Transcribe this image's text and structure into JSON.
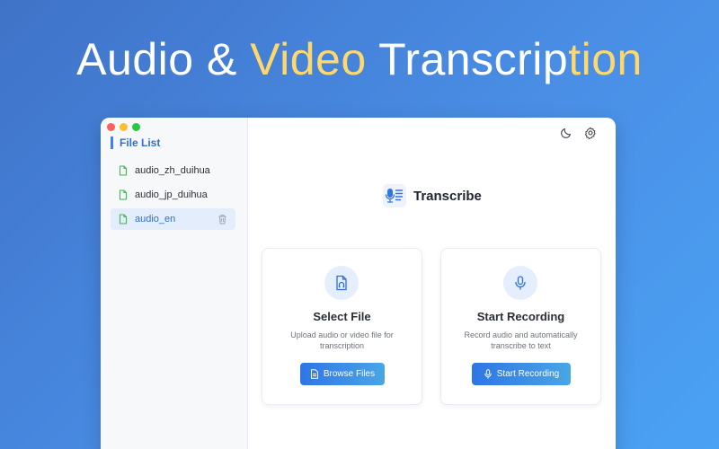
{
  "hero": {
    "title_main": "Audio & ",
    "title_highlight_1": "Video",
    "title_middle": " Transcrip",
    "title_highlight_2": "tion"
  },
  "sidebar": {
    "title": "File List",
    "files": [
      {
        "name": "audio_zh_duihua",
        "active": false
      },
      {
        "name": "audio_jp_duihua",
        "active": false
      },
      {
        "name": "audio_en",
        "active": true
      }
    ]
  },
  "app": {
    "name": "Transcribe"
  },
  "cards": {
    "select_file": {
      "title": "Select File",
      "description": "Upload audio or video file for transcription",
      "button_label": "Browse Files"
    },
    "recording": {
      "title": "Start Recording",
      "description": "Record audio and automatically transcribe to text",
      "button_label": "Start Recording"
    }
  },
  "icons": {
    "theme": "moon-icon",
    "settings": "gear-icon",
    "file": "file-icon",
    "trash": "trash-icon",
    "logo": "mic-transcript-icon",
    "audio_file": "audio-file-icon",
    "mic": "microphone-icon"
  },
  "colors": {
    "accent": "#2f6fd6",
    "file_icon": "#3fb950",
    "highlight_text": "#ffd86b"
  }
}
